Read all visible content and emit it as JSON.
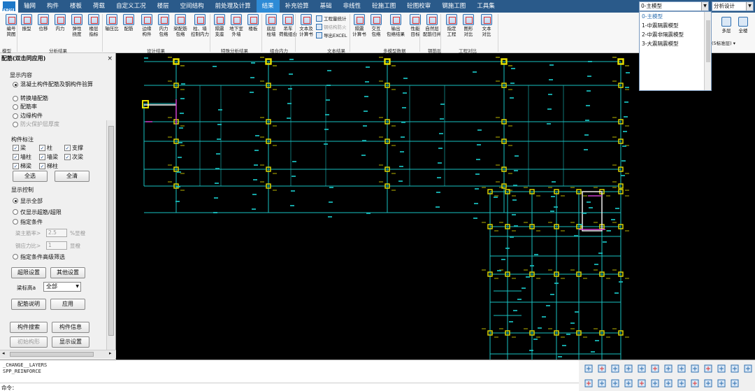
{
  "menubar": {
    "logo_text": "PKPM",
    "items": [
      {
        "label": "轴网",
        "active": false
      },
      {
        "label": "构件",
        "active": false
      },
      {
        "label": "楼板",
        "active": false
      },
      {
        "label": "荷载",
        "active": false
      },
      {
        "label": "自定义工况",
        "active": false
      },
      {
        "label": "楼层",
        "active": false
      },
      {
        "label": "空间结构",
        "active": false
      },
      {
        "label": "前处理及计算",
        "active": false
      },
      {
        "label": "结果",
        "active": true
      },
      {
        "label": "补充验算",
        "active": false
      },
      {
        "label": "基础",
        "active": false
      },
      {
        "label": "非线性",
        "active": false
      },
      {
        "label": "砼施工图",
        "active": false
      },
      {
        "label": "砼图校审",
        "active": false
      },
      {
        "label": "钢施工图",
        "active": false
      },
      {
        "label": "工具集",
        "active": false
      }
    ],
    "model_combo": "0-主模型",
    "design_combo": "分析设计"
  },
  "model_dropdown": {
    "items": [
      "0-主模型",
      "1-中震隔震模型",
      "2-中震非隔震模型",
      "3-大震隔震模型"
    ],
    "selected_index": 0
  },
  "ribbon": {
    "buttons": [
      {
        "label": "编号\n简图",
        "icon": "numbering-icon"
      },
      {
        "label": "振型",
        "icon": "mode-shape-icon"
      },
      {
        "label": "位移",
        "icon": "displacement-icon"
      },
      {
        "label": "内力",
        "icon": "internal-force-icon"
      },
      {
        "label": "弹性\n挠度",
        "icon": "deflection-icon"
      },
      {
        "label": "楼层\n指标",
        "icon": "floor-index-icon"
      },
      {
        "label": "轴压比",
        "icon": "axial-ratio-icon"
      },
      {
        "label": "配筋",
        "icon": "reinforcement-icon"
      },
      {
        "label": "边缘\n构件",
        "icon": "edge-member-icon"
      },
      {
        "label": "内力\n包络",
        "icon": "envelope-icon"
      },
      {
        "label": "梁配筋\n包络",
        "icon": "beam-envelope-icon"
      },
      {
        "label": "柱、墙\n控制内力",
        "icon": "column-wall-icon"
      },
      {
        "label": "隔震\n支座",
        "icon": "isolation-icon"
      },
      {
        "label": "地下室\n外墙",
        "icon": "basement-wall-icon"
      },
      {
        "label": "楼板",
        "icon": "slab-icon"
      },
      {
        "label": "底层\n柱墙",
        "icon": "base-column-icon"
      },
      {
        "label": "吊车\n荷载组合",
        "icon": "crane-icon"
      },
      {
        "label": "文本及\n计算书",
        "icon": "text-report-icon"
      },
      {
        "label": "隔震\n计算书",
        "icon": "isolation-report-icon"
      },
      {
        "label": "交互\n包络",
        "icon": "interactive-envelope-icon"
      },
      {
        "label": "输出\n包络结果",
        "icon": "output-envelope-icon"
      },
      {
        "label": "性能\n目标",
        "icon": "performance-icon"
      },
      {
        "label": "自然层\n配筋归并",
        "icon": "merge-icon"
      },
      {
        "label": "指定\n工程",
        "icon": "project-icon"
      },
      {
        "label": "图形\n对比",
        "icon": "graph-compare-icon"
      },
      {
        "label": "文本\n对比",
        "icon": "text-compare-icon"
      }
    ],
    "small_items": [
      "工程量统计",
      "钢结构防火",
      "导出EXCEL"
    ],
    "groups": [
      "模型",
      "分析结果",
      "设计结果",
      "特殊分析结果",
      "组合内力",
      "文本结果",
      "多模型数据",
      "钢筋层",
      "工程对比"
    ],
    "right_items": [
      {
        "label": "多层",
        "icon": "multi-layer-icon"
      },
      {
        "label": "全楼",
        "icon": "whole-building-icon"
      },
      {
        "label": "(5标准层)",
        "icon": ""
      }
    ]
  },
  "panel": {
    "title": "配筋(双击同应用)",
    "close": "×",
    "display_content_title": "显示内容",
    "display_options": [
      {
        "label": "混凝土构件配筋及钢构件验算",
        "checked": true,
        "disabled": false
      },
      {
        "label": "转换墙配筋",
        "checked": false,
        "disabled": false
      },
      {
        "label": "配筋率",
        "checked": false,
        "disabled": false
      },
      {
        "label": "边缘构件",
        "checked": false,
        "disabled": false
      },
      {
        "label": "防火保护层厚度",
        "checked": false,
        "disabled": true
      }
    ],
    "member_label_title": "构件标注",
    "member_checks": [
      "梁",
      "柱",
      "支撑",
      "墙柱",
      "墙梁",
      "次梁",
      "梯梁",
      "梯柱"
    ],
    "select_all": "全选",
    "clear_all": "全清",
    "display_control_title": "显示控制",
    "control_options": [
      {
        "label": "显示全部",
        "checked": true
      },
      {
        "label": "仅显示超筋/超限",
        "checked": false
      },
      {
        "label": "指定条件",
        "checked": false
      }
    ],
    "beam_ratio_label": "梁主筋率>",
    "beam_ratio_value": "2.5",
    "beam_ratio_unit": "%显橙",
    "steel_stress_label": "钢应力比>",
    "steel_stress_value": "1",
    "steel_stress_unit": "显橙",
    "advanced_filter": "指定条件高级筛选",
    "over_limit_btn": "超限设置",
    "other_settings_btn": "其他设置",
    "beam_height_label": "梁标高a",
    "beam_height_value": "全部",
    "rebar_desc_btn": "配筋说明",
    "apply_btn": "应用",
    "member_search_btn": "构件搜索",
    "member_info_btn": "构件信息",
    "init_draw_btn": "初始构形",
    "display_settings_btn": "显示设置"
  },
  "command": {
    "lines": [
      "_CHANGE__LAYERS",
      "SPP_REINFORCE"
    ],
    "prompt": "命令："
  },
  "colors": {
    "menubar_bg": "#2a5a8a",
    "active_tab": "#2e8bd6",
    "grid_line": "#19c2c2",
    "column": "#e8e000",
    "canvas_bg": "#000000",
    "highlight": "#d040d0"
  }
}
